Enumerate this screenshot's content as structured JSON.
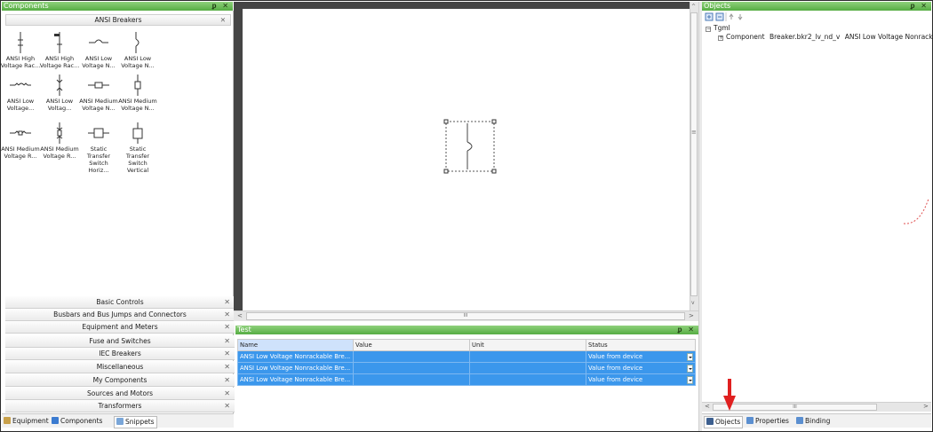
{
  "components_panel": {
    "title": "Components",
    "controls": "ᵱ ✕",
    "group_header": "ANSI Breakers",
    "group_close": "✕",
    "tiles": [
      {
        "line1": "ANSI High",
        "line2": "Voltage Rac...",
        "icon": "breaker-high-voltage-rack-icon"
      },
      {
        "line1": "ANSI High",
        "line2": "Voltage Rac...",
        "icon": "breaker-high-voltage-rack-2-icon"
      },
      {
        "line1": "ANSI Low",
        "line2": "Voltage N...",
        "icon": "breaker-low-voltage-horizontal-icon"
      },
      {
        "line1": "ANSI Low",
        "line2": "Voltage N...",
        "icon": "breaker-low-voltage-vertical-icon"
      },
      {
        "line1": "ANSI Low",
        "line2": "Voltage...",
        "icon": "breaker-low-voltage-rack-h-icon"
      },
      {
        "line1": "ANSI Low",
        "line2": "Voltag...",
        "icon": "breaker-low-voltage-rack-v-icon"
      },
      {
        "line1": "ANSI Medium",
        "line2": "Voltage N...",
        "icon": "breaker-medium-voltage-h-icon"
      },
      {
        "line1": "ANSI Medium",
        "line2": "Voltage N...",
        "icon": "breaker-medium-voltage-v-icon"
      },
      {
        "line1": "ANSI Medium",
        "line2": "Voltage R...",
        "icon": "breaker-medium-voltage-rack-h-icon"
      },
      {
        "line1": "ANSI Medium",
        "line2": "Voltage R...",
        "icon": "breaker-medium-voltage-rack-v-icon"
      },
      {
        "line1": "Static Transfer",
        "line2": "Switch Horiz...",
        "icon": "static-transfer-switch-horizontal-icon"
      },
      {
        "line1": "Static Transfer",
        "line2": "Switch Vertical",
        "icon": "static-transfer-switch-vertical-icon"
      }
    ],
    "categories": [
      "Basic Controls",
      "Busbars and Bus Jumps and Connectors",
      "Equipment and Meters",
      "Fuse and Switches",
      "IEC Breakers",
      "Miscellaneous",
      "My Components",
      "Sources and Motors",
      "Transformers"
    ],
    "category_close": "✕",
    "tabs": [
      "Equipment",
      "Components",
      "Snippets"
    ]
  },
  "canvas": {
    "hscroll_thumb": "III",
    "scroll_left": "<",
    "scroll_right": ">",
    "scroll_up": "^",
    "scroll_down": "v",
    "vscroll_grip": "≡"
  },
  "test_panel": {
    "title": "Test",
    "controls": "ᵱ ✕",
    "columns": [
      "Name",
      "Value",
      "Unit",
      "Status"
    ],
    "rows": [
      {
        "name": "ANSI Low Voltage Nonrackable Bre...",
        "value": "",
        "unit": "",
        "status": "Value from device"
      },
      {
        "name": "ANSI Low Voltage Nonrackable Bre...",
        "value": "",
        "unit": "",
        "status": "Value from device"
      },
      {
        "name": "ANSI Low Voltage Nonrackable Bre...",
        "value": "",
        "unit": "",
        "status": "Value from device"
      }
    ]
  },
  "objects_panel": {
    "title": "Objects",
    "controls": "ᵱ ✕",
    "tree_root": "Tgml",
    "tree_child_type": "Component",
    "tree_child_name": "Breaker.bkr2_lv_nd_v",
    "tree_child_desc": "ANSI Low Voltage Nonrackab",
    "hscroll_thumb": "III",
    "scroll_left": "<",
    "scroll_right": ">",
    "tabs": [
      "Objects",
      "Properties",
      "Binding"
    ],
    "arrow_color": "#e02020"
  }
}
